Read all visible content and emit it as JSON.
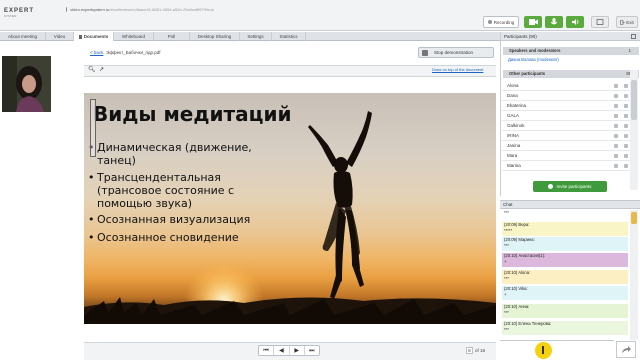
{
  "browser": {
    "url_host": "video.expertsystem.ru",
    "url_path": "/#conference/c4bace41-8601-4654-a52e-20e6cefff679/true"
  },
  "logo": {
    "line1": "EXPERT",
    "line2": "SYSTEM"
  },
  "toolbar": {
    "recording_label": "Recording",
    "exit_label": "Exit"
  },
  "tabs": [
    {
      "label": "About meeting"
    },
    {
      "label": "Video"
    },
    {
      "label": "Documents",
      "active": true
    },
    {
      "label": "Whiteboard"
    },
    {
      "label": "Poll"
    },
    {
      "label": "Desktop Sharing"
    },
    {
      "label": "Settings"
    },
    {
      "label": "Statistics"
    }
  ],
  "document": {
    "back_label": "< back",
    "file_name": "Эффект_Бабочки_пдр.pdf",
    "stop_label": "Stop demonstration",
    "draw_label": "Draw on top of the document"
  },
  "slide": {
    "title": "Виды медитаций",
    "bullets": [
      {
        "lines": [
          "Динамическая (движение,",
          "танец)"
        ]
      },
      {
        "lines": [
          "Трансцендентальная",
          "(трансовое состояние с",
          "помощью звука)"
        ]
      },
      {
        "lines": [
          "Осознанная визуализация"
        ]
      },
      {
        "lines": [
          "Осознанное сновидение"
        ]
      }
    ]
  },
  "pager": {
    "current": "6",
    "total_label": "of 18",
    "first": "⏮",
    "prev": "◀",
    "next": "▶",
    "last": "⏭"
  },
  "participants": {
    "header": "Participants (90)",
    "speakers_header": "Speakers and moderators",
    "speakers_count": "1",
    "moderator": "Диана Валова (moderator)",
    "others_header": "Other participants",
    "others_count": "89",
    "list": [
      "Alona",
      "Dana",
      "Ekaterina",
      "GALA",
      "Galkinok",
      "IRINA",
      "Janina",
      "Mara",
      "Marina"
    ],
    "invite_label": "Invite participants"
  },
  "chat": {
    "header": "Chat",
    "messages": [
      {
        "who": "",
        "body": "***",
        "bg": "#ffffff"
      },
      {
        "who": "(20:09) Вера:",
        "body": "*****",
        "bg": "#f9f5c7"
      },
      {
        "who": "(20:09) Марина:",
        "body": "***",
        "bg": "#dff4f7"
      },
      {
        "who": "(20:10) Анастасия(1):",
        "body": "+",
        "bg": "#dcb8dd"
      },
      {
        "who": "(20:10) Alona:",
        "body": "***",
        "bg": "#fbefc3"
      },
      {
        "who": "(20:10) Vika:",
        "body": "+",
        "bg": "#dff4f7"
      },
      {
        "who": "(20:10) Анна:",
        "body": "***",
        "bg": "#e5f4d4"
      },
      {
        "who": "(20:10) Елена Тенерова:",
        "body": "***",
        "bg": "#eaf6de"
      }
    ]
  }
}
